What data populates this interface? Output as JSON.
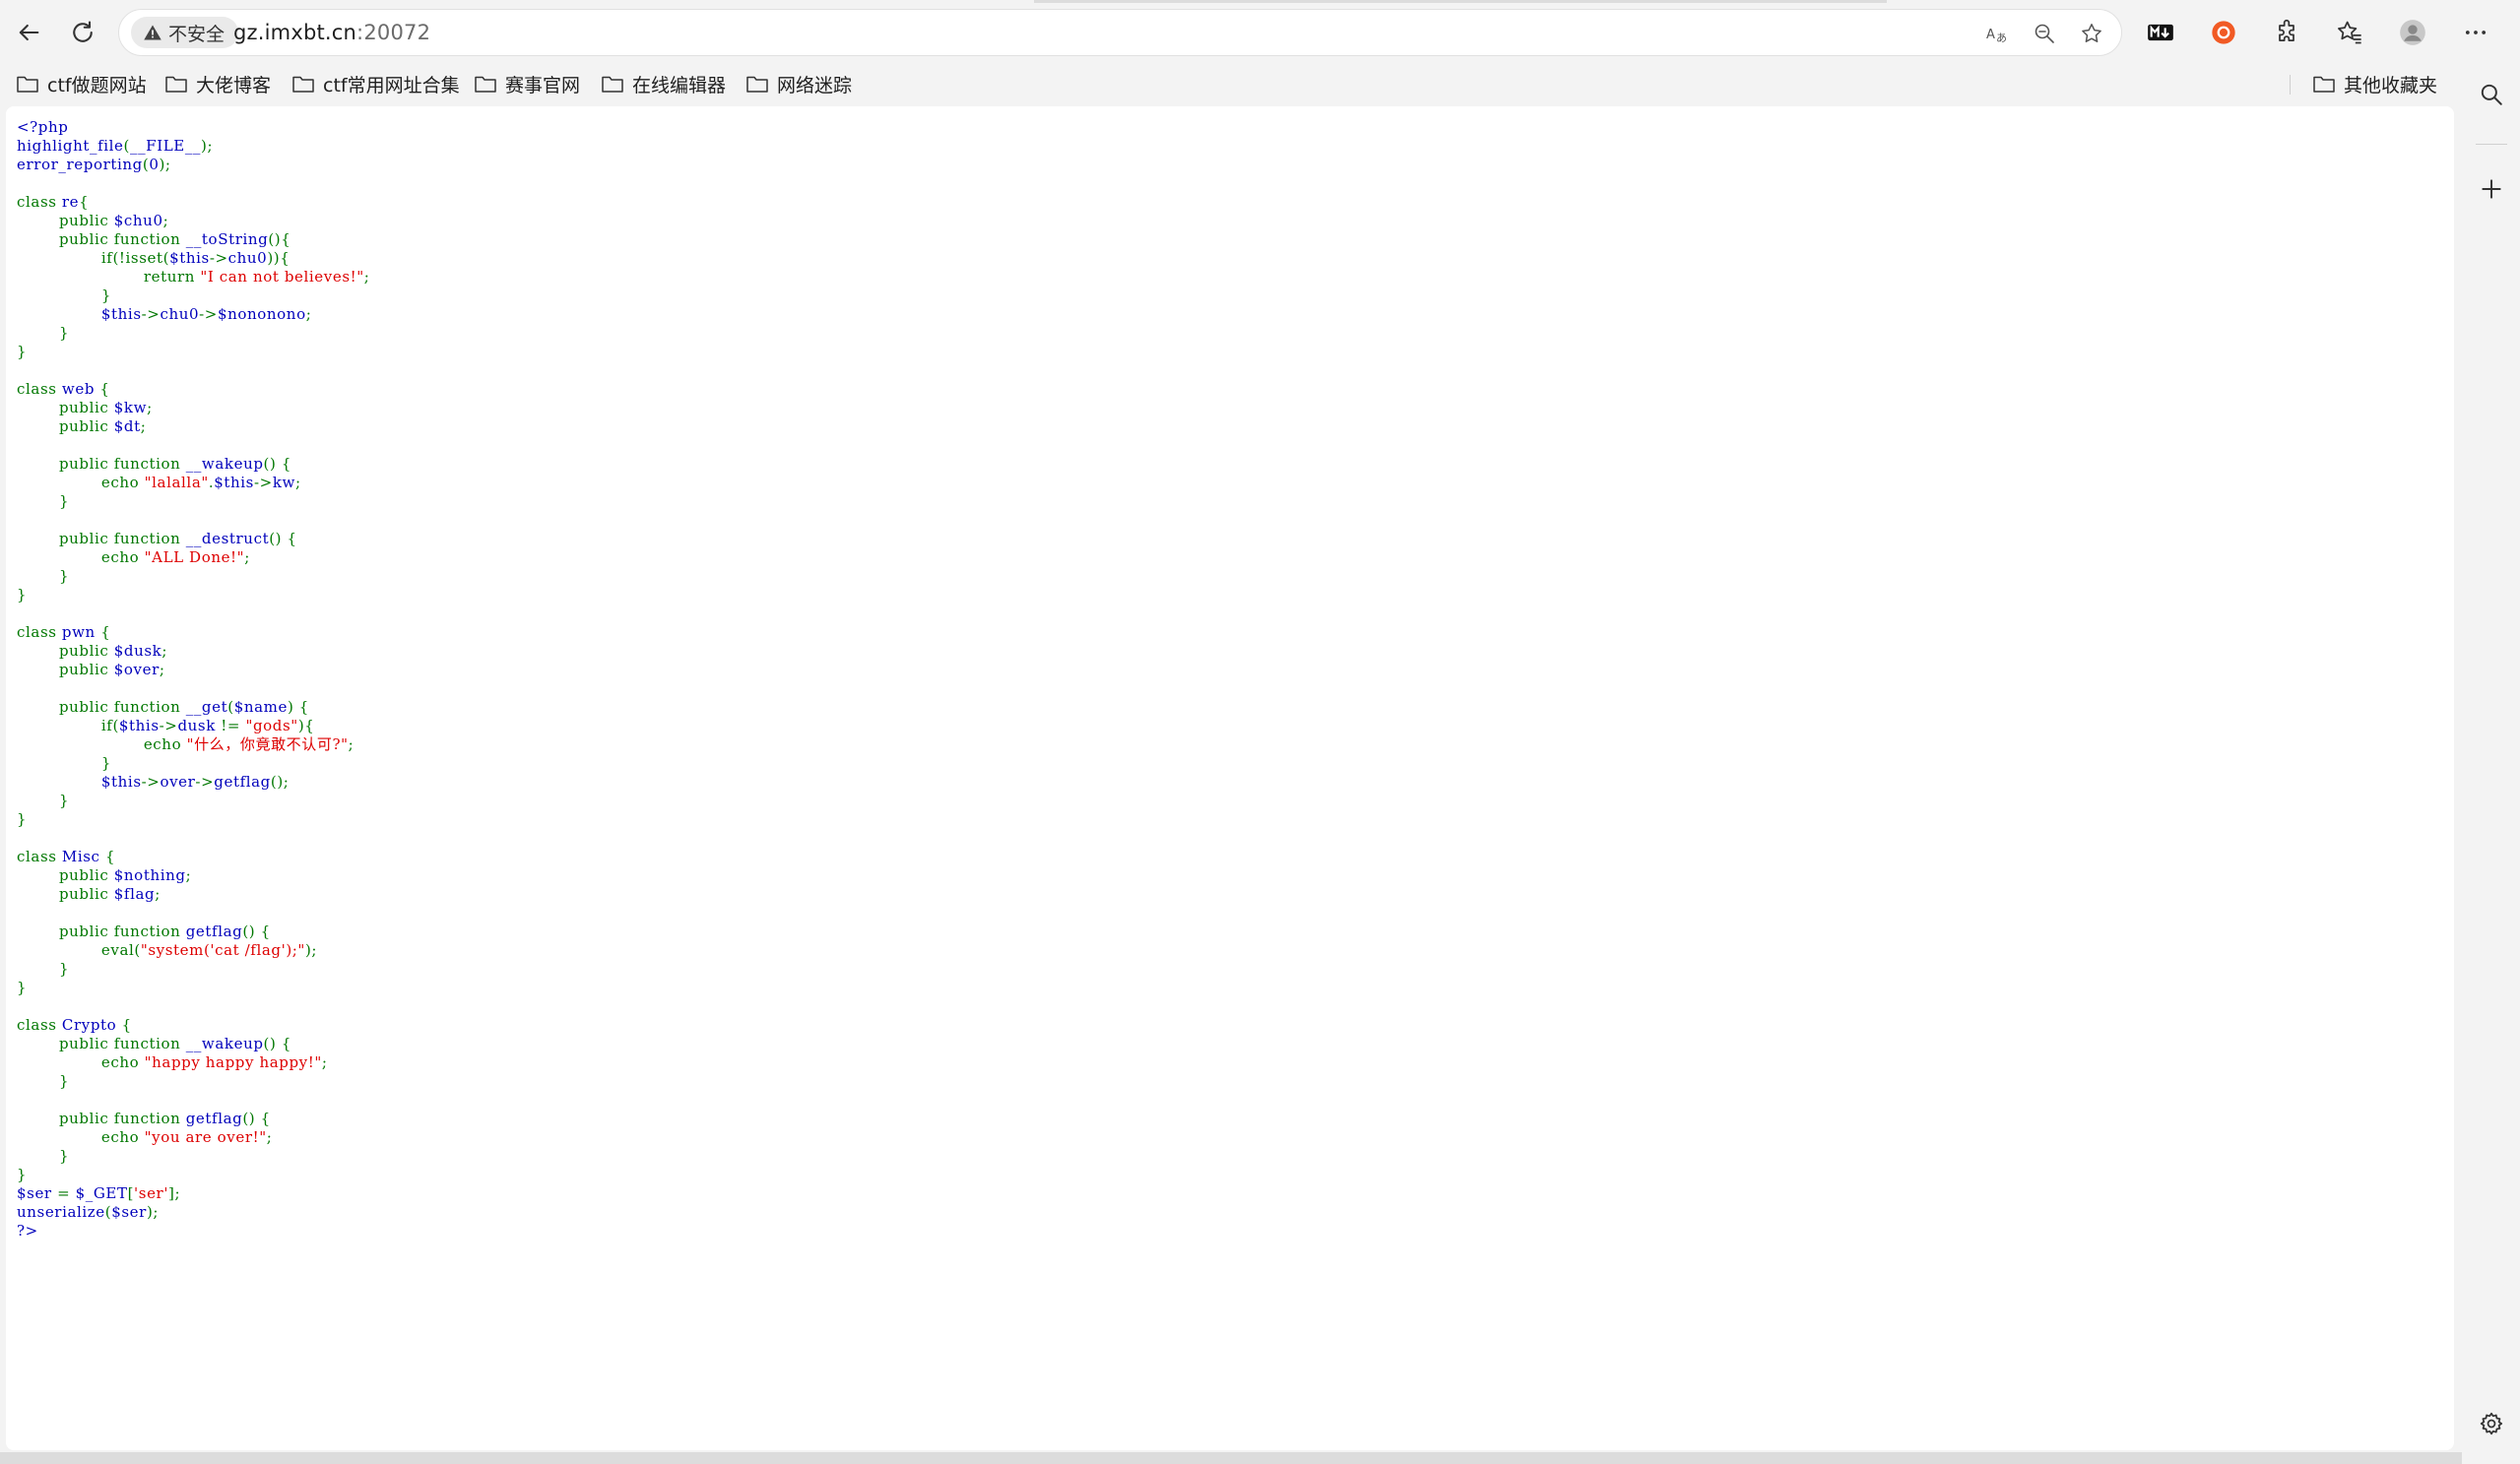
{
  "browser": {
    "security_label": "不安全",
    "url_host": "gz.imxbt.cn",
    "url_rest": ":20072"
  },
  "bookmarks": [
    "ctf做题网站",
    "大佬博客",
    "ctf常用网址合集",
    "赛事官网",
    "在线编辑器",
    "网络迷踪"
  ],
  "other_bookmarks": "其他收藏夹",
  "source_code": [
    [
      [
        "d",
        "<?php"
      ]
    ],
    [
      [
        "d",
        "highlight_file"
      ],
      [
        "k",
        "("
      ],
      [
        "d",
        "__FILE__"
      ],
      [
        "k",
        ");"
      ]
    ],
    [
      [
        "d",
        "error_reporting"
      ],
      [
        "k",
        "("
      ],
      [
        "d",
        "0"
      ],
      [
        "k",
        ");"
      ]
    ],
    [],
    [
      [
        "k",
        "class "
      ],
      [
        "d",
        "re"
      ],
      [
        "k",
        "{"
      ]
    ],
    [
      [
        "k",
        "        public "
      ],
      [
        "d",
        "$chu0"
      ],
      [
        "k",
        ";"
      ]
    ],
    [
      [
        "k",
        "        public function "
      ],
      [
        "d",
        "__toString"
      ],
      [
        "k",
        "(){"
      ]
    ],
    [
      [
        "k",
        "                if(!isset("
      ],
      [
        "d",
        "$this"
      ],
      [
        "k",
        "->"
      ],
      [
        "d",
        "chu0"
      ],
      [
        "k",
        ")){"
      ]
    ],
    [
      [
        "k",
        "                        return "
      ],
      [
        "s",
        "\"I can not believes!\""
      ],
      [
        "k",
        ";"
      ]
    ],
    [
      [
        "k",
        "                }"
      ]
    ],
    [
      [
        "k",
        "                "
      ],
      [
        "d",
        "$this"
      ],
      [
        "k",
        "->"
      ],
      [
        "d",
        "chu0"
      ],
      [
        "k",
        "->"
      ],
      [
        "d",
        "$nononono"
      ],
      [
        "k",
        ";"
      ]
    ],
    [
      [
        "k",
        "        }"
      ]
    ],
    [
      [
        "k",
        "}"
      ]
    ],
    [],
    [
      [
        "k",
        "class "
      ],
      [
        "d",
        "web "
      ],
      [
        "k",
        "{"
      ]
    ],
    [
      [
        "k",
        "        public "
      ],
      [
        "d",
        "$kw"
      ],
      [
        "k",
        ";"
      ]
    ],
    [
      [
        "k",
        "        public "
      ],
      [
        "d",
        "$dt"
      ],
      [
        "k",
        ";"
      ]
    ],
    [],
    [
      [
        "k",
        "        public function "
      ],
      [
        "d",
        "__wakeup"
      ],
      [
        "k",
        "() {"
      ]
    ],
    [
      [
        "k",
        "                echo "
      ],
      [
        "s",
        "\"lalalla\""
      ],
      [
        "k",
        "."
      ],
      [
        "d",
        "$this"
      ],
      [
        "k",
        "->"
      ],
      [
        "d",
        "kw"
      ],
      [
        "k",
        ";"
      ]
    ],
    [
      [
        "k",
        "        }"
      ]
    ],
    [],
    [
      [
        "k",
        "        public function "
      ],
      [
        "d",
        "__destruct"
      ],
      [
        "k",
        "() {"
      ]
    ],
    [
      [
        "k",
        "                echo "
      ],
      [
        "s",
        "\"ALL Done!\""
      ],
      [
        "k",
        ";"
      ]
    ],
    [
      [
        "k",
        "        }"
      ]
    ],
    [
      [
        "k",
        "}"
      ]
    ],
    [],
    [
      [
        "k",
        "class "
      ],
      [
        "d",
        "pwn "
      ],
      [
        "k",
        "{"
      ]
    ],
    [
      [
        "k",
        "        public "
      ],
      [
        "d",
        "$dusk"
      ],
      [
        "k",
        ";"
      ]
    ],
    [
      [
        "k",
        "        public "
      ],
      [
        "d",
        "$over"
      ],
      [
        "k",
        ";"
      ]
    ],
    [],
    [
      [
        "k",
        "        public function "
      ],
      [
        "d",
        "__get"
      ],
      [
        "k",
        "("
      ],
      [
        "d",
        "$name"
      ],
      [
        "k",
        ") {"
      ]
    ],
    [
      [
        "k",
        "                if("
      ],
      [
        "d",
        "$this"
      ],
      [
        "k",
        "->"
      ],
      [
        "d",
        "dusk "
      ],
      [
        "k",
        "!= "
      ],
      [
        "s",
        "\"gods\""
      ],
      [
        "k",
        "){"
      ]
    ],
    [
      [
        "k",
        "                        echo "
      ],
      [
        "s",
        "\"什么，你竟敢不认可?\""
      ],
      [
        "k",
        ";"
      ]
    ],
    [
      [
        "k",
        "                }"
      ]
    ],
    [
      [
        "k",
        "                "
      ],
      [
        "d",
        "$this"
      ],
      [
        "k",
        "->"
      ],
      [
        "d",
        "over"
      ],
      [
        "k",
        "->"
      ],
      [
        "d",
        "getflag"
      ],
      [
        "k",
        "();"
      ]
    ],
    [
      [
        "k",
        "        }"
      ]
    ],
    [
      [
        "k",
        "}"
      ]
    ],
    [],
    [
      [
        "k",
        "class "
      ],
      [
        "d",
        "Misc "
      ],
      [
        "k",
        "{"
      ]
    ],
    [
      [
        "k",
        "        public "
      ],
      [
        "d",
        "$nothing"
      ],
      [
        "k",
        ";"
      ]
    ],
    [
      [
        "k",
        "        public "
      ],
      [
        "d",
        "$flag"
      ],
      [
        "k",
        ";"
      ]
    ],
    [],
    [
      [
        "k",
        "        public function "
      ],
      [
        "d",
        "getflag"
      ],
      [
        "k",
        "() {"
      ]
    ],
    [
      [
        "k",
        "                eval("
      ],
      [
        "s",
        "\"system('cat /flag');\""
      ],
      [
        "k",
        ");"
      ]
    ],
    [
      [
        "k",
        "        }"
      ]
    ],
    [
      [
        "k",
        "}"
      ]
    ],
    [],
    [
      [
        "k",
        "class "
      ],
      [
        "d",
        "Crypto "
      ],
      [
        "k",
        "{"
      ]
    ],
    [
      [
        "k",
        "        public function "
      ],
      [
        "d",
        "__wakeup"
      ],
      [
        "k",
        "() {"
      ]
    ],
    [
      [
        "k",
        "                echo "
      ],
      [
        "s",
        "\"happy happy happy!\""
      ],
      [
        "k",
        ";"
      ]
    ],
    [
      [
        "k",
        "        }"
      ]
    ],
    [],
    [
      [
        "k",
        "        public function "
      ],
      [
        "d",
        "getflag"
      ],
      [
        "k",
        "() {"
      ]
    ],
    [
      [
        "k",
        "                echo "
      ],
      [
        "s",
        "\"you are over!\""
      ],
      [
        "k",
        ";"
      ]
    ],
    [
      [
        "k",
        "        }"
      ]
    ],
    [
      [
        "k",
        "}"
      ]
    ],
    [
      [
        "d",
        "$ser "
      ],
      [
        "k",
        "= "
      ],
      [
        "d",
        "$_GET"
      ],
      [
        "k",
        "["
      ],
      [
        "s",
        "'ser'"
      ],
      [
        "k",
        "];"
      ]
    ],
    [
      [
        "d",
        "unserialize"
      ],
      [
        "k",
        "("
      ],
      [
        "d",
        "$ser"
      ],
      [
        "k",
        ");"
      ]
    ],
    [
      [
        "d",
        "?>"
      ]
    ]
  ]
}
